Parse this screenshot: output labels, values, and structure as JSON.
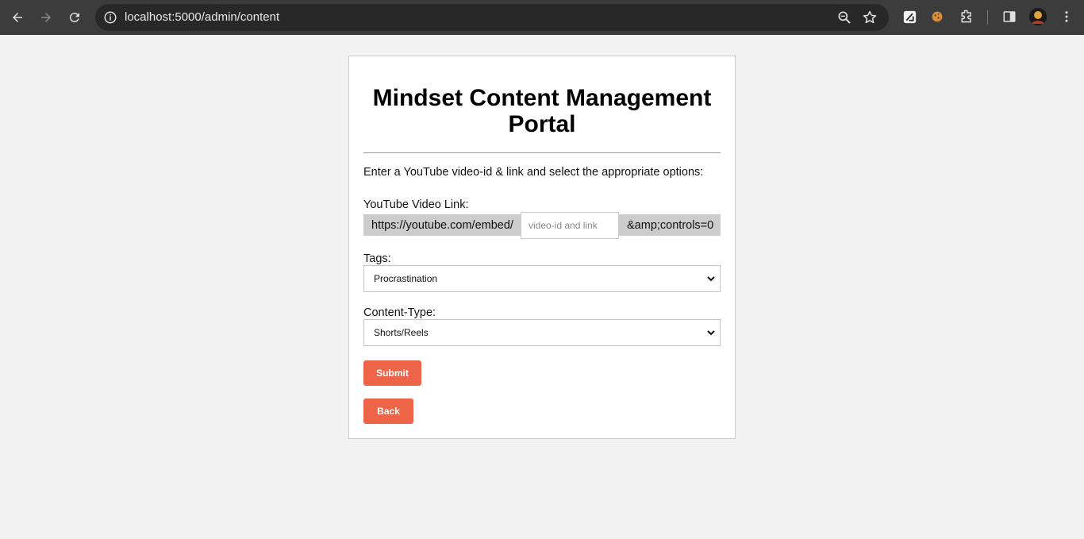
{
  "browser": {
    "url": "localhost:5000/admin/content",
    "accent": "#3c3c3c"
  },
  "page": {
    "title": "Mindset Content Management Portal",
    "intro": "Enter a YouTube video-id & link and select the appropriate options:",
    "video_link": {
      "label": "YouTube Video Link:",
      "prefix": "https://youtube.com/embed/",
      "placeholder": "video-id and link",
      "value": "",
      "suffix": "&amp;controls=0"
    },
    "tags": {
      "label": "Tags:",
      "selected": "Procrastination"
    },
    "content_type": {
      "label": "Content-Type:",
      "selected": "Shorts/Reels"
    },
    "submit_label": "Submit",
    "back_label": "Back",
    "button_color": "#ee6449"
  }
}
